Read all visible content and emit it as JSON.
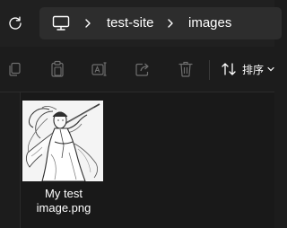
{
  "address_bar": {
    "refresh_icon": "refresh-icon",
    "root_icon": "this-pc-icon",
    "breadcrumbs": [
      {
        "label": "test-site"
      },
      {
        "label": "images"
      }
    ]
  },
  "toolbar": {
    "buttons": [
      {
        "icon": "copy-icon"
      },
      {
        "icon": "paste-icon"
      },
      {
        "icon": "rename-icon"
      },
      {
        "icon": "share-icon"
      },
      {
        "icon": "delete-icon"
      }
    ],
    "sort_label": "排序"
  },
  "files": [
    {
      "name": "My test\nimage.png",
      "type": "image",
      "thumbnail": "ink-sketch-swordsman"
    }
  ],
  "colors": {
    "background": "#1c1c1c",
    "address_box": "#2d2d2d",
    "disabled_icon": "#6e6e6e",
    "text": "#ffffff"
  }
}
